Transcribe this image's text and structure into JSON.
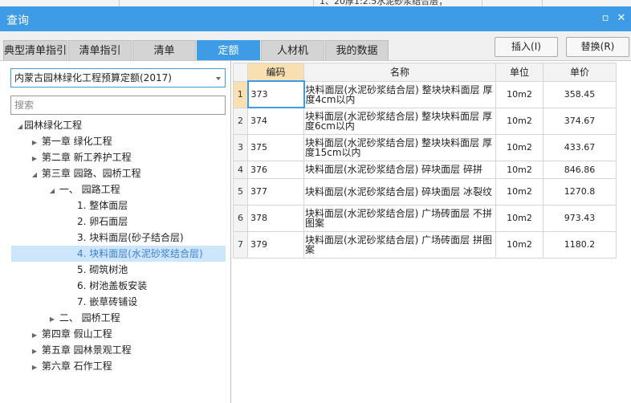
{
  "bg_text": "1、20厚1:2.5水泥砂浆结合层；",
  "window": {
    "title": "查询",
    "restore_glyph": "▫",
    "close_glyph": "✕"
  },
  "tabs": [
    {
      "label": "典型清单指引"
    },
    {
      "label": "清单指引"
    },
    {
      "label": "清单"
    },
    {
      "label": "定额",
      "active": true
    },
    {
      "label": "人材机"
    },
    {
      "label": "我的数据"
    }
  ],
  "buttons": {
    "insert": "插入(I)",
    "replace": "替换(R)"
  },
  "quota_selector": {
    "value": "内蒙古园林绿化工程预算定额(2017)"
  },
  "search": {
    "placeholder": "搜索",
    "value": ""
  },
  "tree": {
    "root": "园林绿化工程",
    "ch1": "第一章 绿化工程",
    "ch2": "第二章 新工养护工程",
    "ch3": "第三章 园路、园桥工程",
    "sec1": "一、 园路工程",
    "items": [
      "1. 整体面层",
      "2. 卵石面层",
      "3. 块料面层(砂子结合层)",
      "4. 块料面层(水泥砂浆结合层)",
      "5. 砌筑树池",
      "6. 树池盖板安装",
      "7. 嵌草砖铺设"
    ],
    "sec2": "二、 园桥工程",
    "ch4": "第四章 假山工程",
    "ch5": "第五章 园林景观工程",
    "ch6": "第六章 石作工程"
  },
  "table": {
    "headers": {
      "code": "编码",
      "name": "名称",
      "unit": "单位",
      "price": "单价"
    },
    "rows": [
      {
        "no": "1",
        "code": "373",
        "name": "块料面层(水泥砂浆结合层) 整块块料面层 厚度4cm以内",
        "unit": "10m2",
        "price": "358.45"
      },
      {
        "no": "2",
        "code": "374",
        "name": "块料面层(水泥砂浆结合层) 整块块料面层 厚度6cm以内",
        "unit": "10m2",
        "price": "374.67"
      },
      {
        "no": "3",
        "code": "375",
        "name": "块料面层(水泥砂浆结合层) 整块块料面层 厚度15cm以内",
        "unit": "10m2",
        "price": "433.67"
      },
      {
        "no": "4",
        "code": "376",
        "name": "块料面层(水泥砂浆结合层) 碎块面层 碎拼",
        "unit": "10m2",
        "price": "846.86"
      },
      {
        "no": "5",
        "code": "377",
        "name": "块料面层(水泥砂浆结合层) 碎块面层 冰裂纹",
        "unit": "10m2",
        "price": "1270.8"
      },
      {
        "no": "6",
        "code": "378",
        "name": "块料面层(水泥砂浆结合层) 广场砖面层 不拼图案",
        "unit": "10m2",
        "price": "973.43"
      },
      {
        "no": "7",
        "code": "379",
        "name": "块料面层(水泥砂浆结合层) 广场砖面层 拼图案",
        "unit": "10m2",
        "price": "1180.2"
      }
    ]
  },
  "colors": {
    "accent": "#3d9ce5",
    "header_highlight": "#f9e0b2",
    "selection": "#cde6fb"
  }
}
